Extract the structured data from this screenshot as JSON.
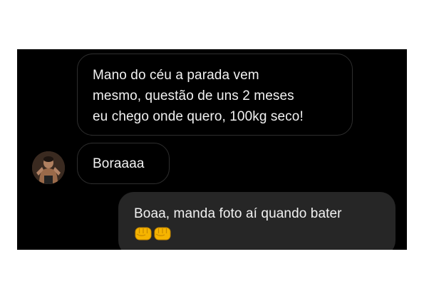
{
  "messages": [
    {
      "direction": "incoming",
      "lines": [
        "Mano do céu a parada vem",
        "mesmo, questão de uns 2 meses",
        "eu chego onde quero, 100kg seco!"
      ]
    },
    {
      "direction": "incoming",
      "lines": [
        "Boraaaa"
      ],
      "avatar": "contact-avatar"
    },
    {
      "direction": "outgoing",
      "lines": [
        "Boaa, manda foto aí quando bater"
      ],
      "emoji": [
        "fist-bump-icon",
        "fist-bump-icon"
      ]
    }
  ],
  "colors": {
    "background": "#000000",
    "incoming_border": "#2e2e2e",
    "outgoing_bubble": "#262626",
    "text": "#f2f2f2",
    "emoji_yellow": "#f5b400"
  }
}
